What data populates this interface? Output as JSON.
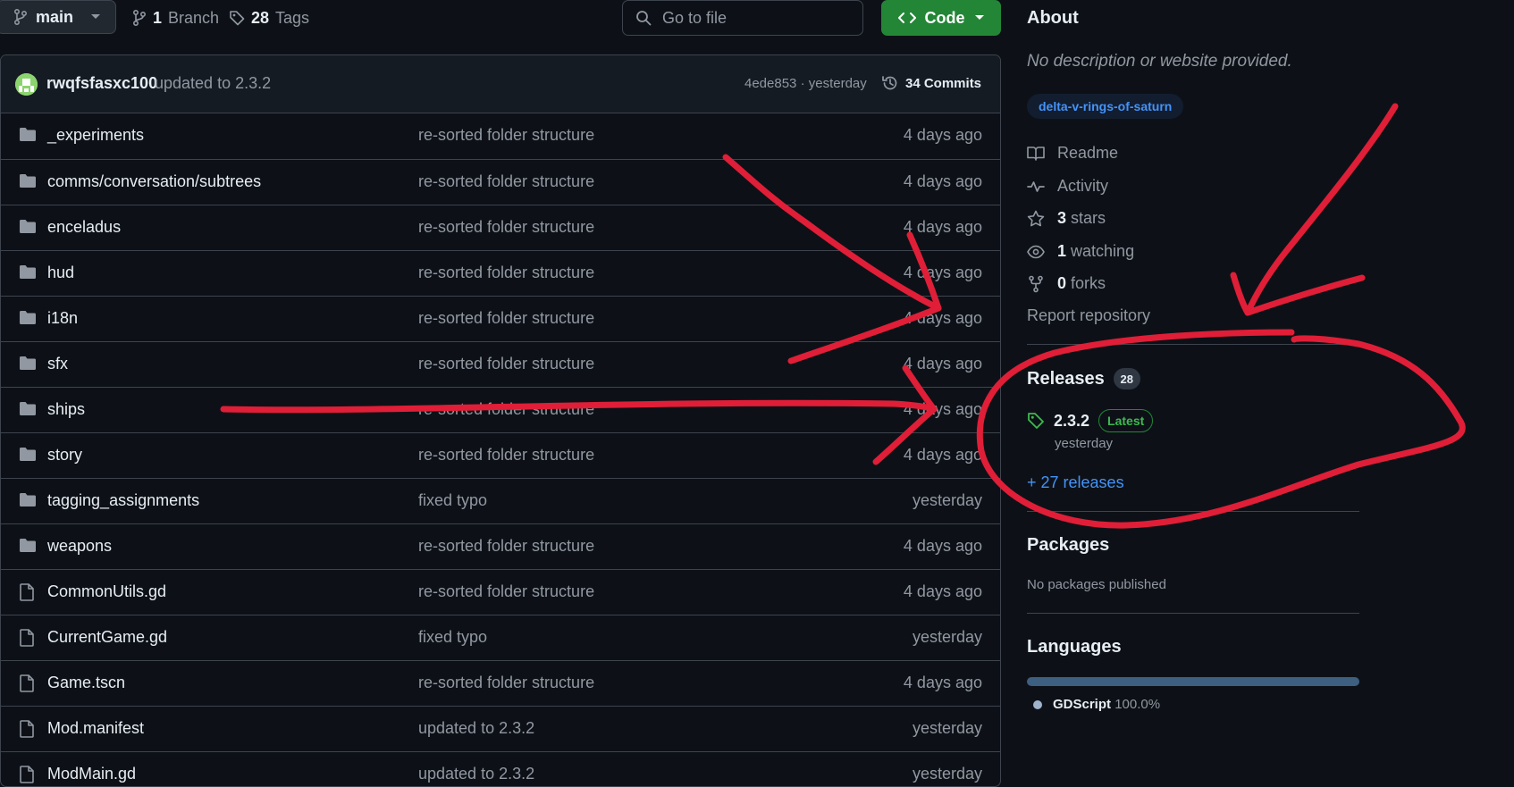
{
  "topbar": {
    "branch": "main",
    "branches_count": "1",
    "branches_label": "Branch",
    "tags_count": "28",
    "tags_label": "Tags",
    "search_placeholder": "Go to file",
    "code_button": "Code"
  },
  "commit": {
    "author": "rwqfsfasxc100",
    "message": "updated to 2.3.2",
    "hash_time": "4ede853 · yesterday",
    "commits_label": "34 Commits"
  },
  "files": [
    {
      "type": "folder",
      "name": "_experiments",
      "message": "re-sorted folder structure",
      "date": "4 days ago"
    },
    {
      "type": "folder",
      "name": "comms/conversation/subtrees",
      "message": "re-sorted folder structure",
      "date": "4 days ago"
    },
    {
      "type": "folder",
      "name": "enceladus",
      "message": "re-sorted folder structure",
      "date": "4 days ago"
    },
    {
      "type": "folder",
      "name": "hud",
      "message": "re-sorted folder structure",
      "date": "4 days ago"
    },
    {
      "type": "folder",
      "name": "i18n",
      "message": "re-sorted folder structure",
      "date": "4 days ago"
    },
    {
      "type": "folder",
      "name": "sfx",
      "message": "re-sorted folder structure",
      "date": "4 days ago"
    },
    {
      "type": "folder",
      "name": "ships",
      "message": "re-sorted folder structure",
      "date": "4 days ago"
    },
    {
      "type": "folder",
      "name": "story",
      "message": "re-sorted folder structure",
      "date": "4 days ago"
    },
    {
      "type": "folder",
      "name": "tagging_assignments",
      "message": "fixed typo",
      "date": "yesterday"
    },
    {
      "type": "folder",
      "name": "weapons",
      "message": "re-sorted folder structure",
      "date": "4 days ago"
    },
    {
      "type": "file",
      "name": "CommonUtils.gd",
      "message": "re-sorted folder structure",
      "date": "4 days ago"
    },
    {
      "type": "file",
      "name": "CurrentGame.gd",
      "message": "fixed typo",
      "date": "yesterday"
    },
    {
      "type": "file",
      "name": "Game.tscn",
      "message": "re-sorted folder structure",
      "date": "4 days ago"
    },
    {
      "type": "file",
      "name": "Mod.manifest",
      "message": "updated to 2.3.2",
      "date": "yesterday"
    },
    {
      "type": "file",
      "name": "ModMain.gd",
      "message": "updated to 2.3.2",
      "date": "yesterday"
    }
  ],
  "about": {
    "title": "About",
    "description": "No description or website provided.",
    "topic": "delta-v-rings-of-saturn",
    "readme": "Readme",
    "activity": "Activity",
    "stars_count": "3",
    "stars_label": "stars",
    "watching_count": "1",
    "watching_label": "watching",
    "forks_count": "0",
    "forks_label": "forks",
    "report": "Report repository"
  },
  "releases": {
    "title": "Releases",
    "count": "28",
    "latest_version": "2.3.2",
    "latest_badge": "Latest",
    "latest_date": "yesterday",
    "more_link": "+ 27 releases"
  },
  "packages": {
    "title": "Packages",
    "empty": "No packages published"
  },
  "languages": {
    "title": "Languages",
    "items": [
      {
        "name": "GDScript",
        "percent": "100.0%",
        "share": 1.0,
        "color": "#9fb4cc"
      }
    ]
  },
  "colors": {
    "background": "#0d1117",
    "accent_green": "#238636",
    "link_blue": "#4493f8",
    "annotation_red": "#e01e37"
  }
}
